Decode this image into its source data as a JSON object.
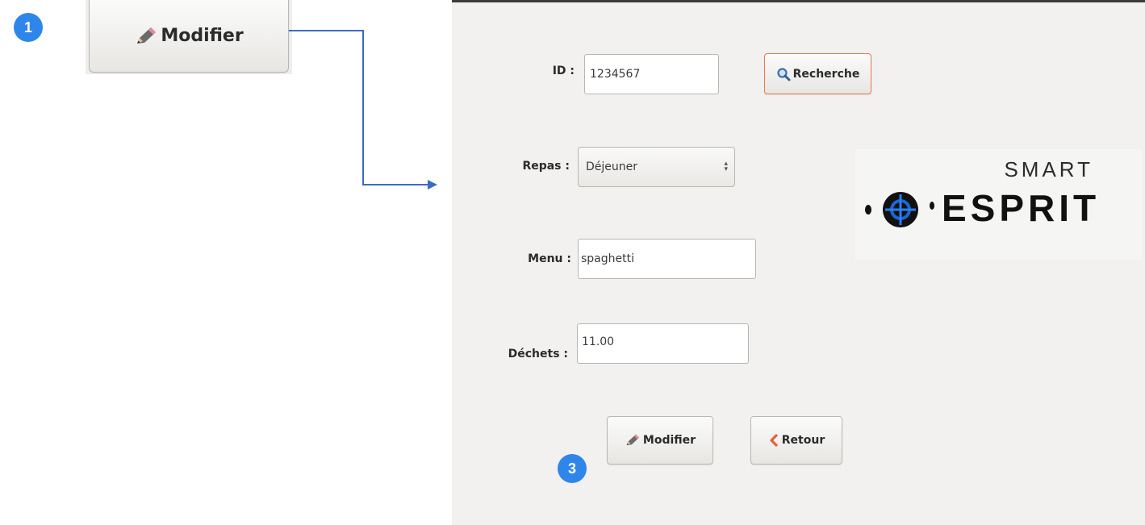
{
  "callouts": {
    "step1": "1",
    "step3": "3"
  },
  "zoom_button": {
    "label": "Modifier",
    "icon": "pencil-icon"
  },
  "form": {
    "id_label": "ID :",
    "id_value": "1234567",
    "search_button": "Recherche",
    "repas_label": "Repas :",
    "repas_value": "Déjeuner",
    "menu_label": "Menu :",
    "menu_value": "spaghetti",
    "dechets_label": "Déchets :",
    "dechets_value": "11.00",
    "modifier_button": "Modifier",
    "retour_button": "Retour"
  },
  "logo": {
    "top_text": "SMART",
    "main_text": "ESPRIT"
  },
  "colors": {
    "callout": "#2f86ea",
    "arrow": "#3d6bc4",
    "search_border": "#e8794a",
    "retour_icon": "#e8603a"
  }
}
